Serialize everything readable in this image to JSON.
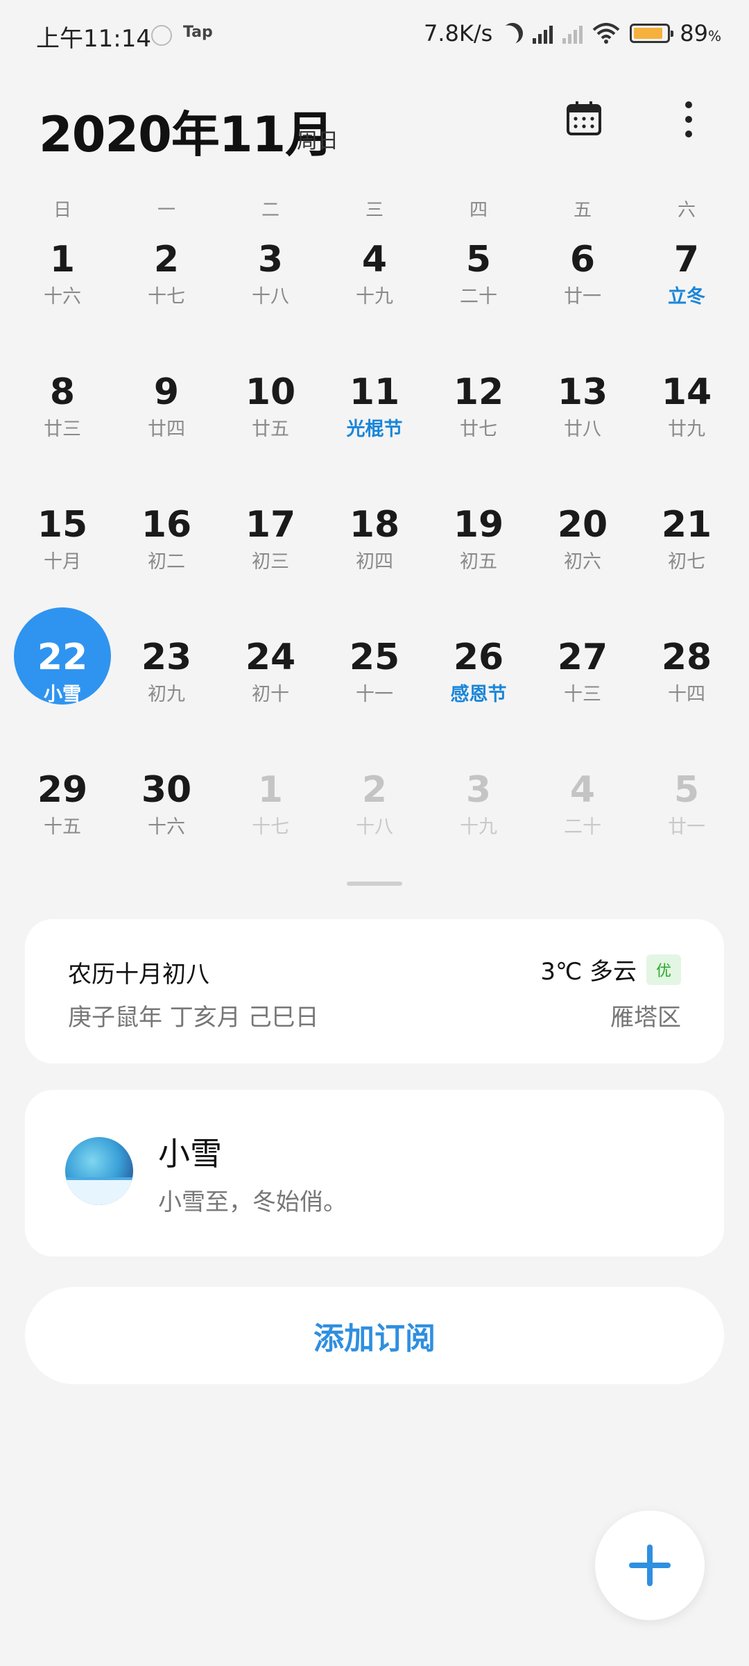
{
  "status_bar": {
    "time": "上午11:14",
    "app_label": "Tap",
    "net_speed": "7.8K/s",
    "battery": "89",
    "battery_unit": "%",
    "battery_level": 0.89,
    "battery_color": "#f4b13d"
  },
  "header": {
    "month_title": "2020年11月",
    "weekday": "周日",
    "calendar_icon": "calendar-icon",
    "more_icon": "more-vertical-icon"
  },
  "weekdays": [
    "日",
    "一",
    "二",
    "三",
    "四",
    "五",
    "六"
  ],
  "calendar": {
    "weeks": [
      [
        {
          "day": "1",
          "lunar": "十六"
        },
        {
          "day": "2",
          "lunar": "十七"
        },
        {
          "day": "3",
          "lunar": "十八"
        },
        {
          "day": "4",
          "lunar": "十九"
        },
        {
          "day": "5",
          "lunar": "二十"
        },
        {
          "day": "6",
          "lunar": "廿一"
        },
        {
          "day": "7",
          "lunar": "立冬"
        }
      ],
      [
        {
          "day": "8",
          "lunar": "廿三"
        },
        {
          "day": "9",
          "lunar": "廿四"
        },
        {
          "day": "10",
          "lunar": "廿五"
        },
        {
          "day": "11",
          "lunar": "光棍节"
        },
        {
          "day": "12",
          "lunar": "廿七"
        },
        {
          "day": "13",
          "lunar": "廿八"
        },
        {
          "day": "14",
          "lunar": "廿九"
        }
      ],
      [
        {
          "day": "15",
          "lunar": "十月"
        },
        {
          "day": "16",
          "lunar": "初二"
        },
        {
          "day": "17",
          "lunar": "初三"
        },
        {
          "day": "18",
          "lunar": "初四"
        },
        {
          "day": "19",
          "lunar": "初五"
        },
        {
          "day": "20",
          "lunar": "初六"
        },
        {
          "day": "21",
          "lunar": "初七"
        }
      ],
      [
        {
          "day": "22",
          "lunar": "小雪"
        },
        {
          "day": "23",
          "lunar": "初九"
        },
        {
          "day": "24",
          "lunar": "初十"
        },
        {
          "day": "25",
          "lunar": "十一"
        },
        {
          "day": "26",
          "lunar": "感恩节"
        },
        {
          "day": "27",
          "lunar": "十三"
        },
        {
          "day": "28",
          "lunar": "十四"
        }
      ],
      [
        {
          "day": "29",
          "lunar": "十五"
        },
        {
          "day": "30",
          "lunar": "十六"
        },
        {
          "day": "1",
          "lunar": "十七"
        },
        {
          "day": "2",
          "lunar": "十八"
        },
        {
          "day": "3",
          "lunar": "十九"
        },
        {
          "day": "4",
          "lunar": "二十"
        },
        {
          "day": "5",
          "lunar": "廿一"
        }
      ]
    ],
    "highlight_color": "#1a86d8",
    "today_color": "#2f94f0"
  },
  "info_card": {
    "lunar_date": "农历十月初八",
    "ganzhi": "庚子鼠年 丁亥月 己巳日",
    "weather": "3℃ 多云",
    "aqi": "优",
    "district": "雁塔区"
  },
  "subscription": {
    "title": "小雪",
    "description": "小雪至，冬始俏。"
  },
  "add_subscription_label": "添加订阅",
  "fab_icon": "plus-icon"
}
